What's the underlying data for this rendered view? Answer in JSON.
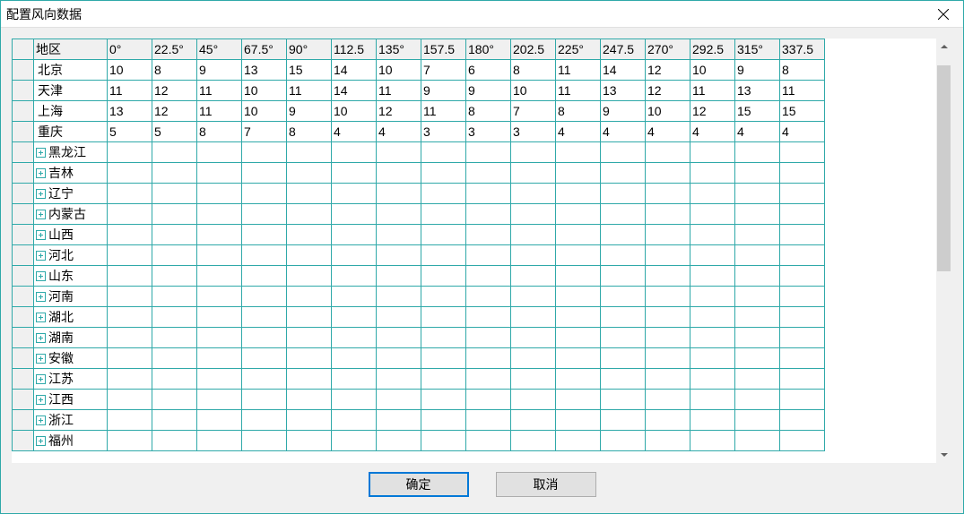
{
  "window": {
    "title": "配置风向数据"
  },
  "table": {
    "region_header": "地区",
    "columns": [
      "0°",
      "22.5°",
      "45°",
      "67.5°",
      "90°",
      "112.5",
      "135°",
      "157.5",
      "180°",
      "202.5",
      "225°",
      "247.5",
      "270°",
      "292.5",
      "315°",
      "337.5"
    ],
    "data_rows": [
      {
        "region": "北京",
        "values": [
          "10",
          "8",
          "9",
          "13",
          "15",
          "14",
          "10",
          "7",
          "6",
          "8",
          "11",
          "14",
          "12",
          "10",
          "9",
          "8"
        ]
      },
      {
        "region": "天津",
        "values": [
          "11",
          "12",
          "11",
          "10",
          "11",
          "14",
          "11",
          "9",
          "9",
          "10",
          "11",
          "13",
          "12",
          "11",
          "13",
          "11"
        ]
      },
      {
        "region": "上海",
        "values": [
          "13",
          "12",
          "11",
          "10",
          "9",
          "10",
          "12",
          "11",
          "8",
          "7",
          "8",
          "9",
          "10",
          "12",
          "15",
          "15"
        ]
      },
      {
        "region": "重庆",
        "values": [
          "5",
          "5",
          "8",
          "7",
          "8",
          "4",
          "4",
          "3",
          "3",
          "3",
          "4",
          "4",
          "4",
          "4",
          "4",
          "4"
        ]
      }
    ],
    "expandable_rows": [
      "黑龙江",
      "吉林",
      "辽宁",
      "内蒙古",
      "山西",
      "河北",
      "山东",
      "河南",
      "湖北",
      "湖南",
      "安徽",
      "江苏",
      "江西",
      "浙江",
      "福州"
    ]
  },
  "buttons": {
    "ok": "确定",
    "cancel": "取消"
  }
}
